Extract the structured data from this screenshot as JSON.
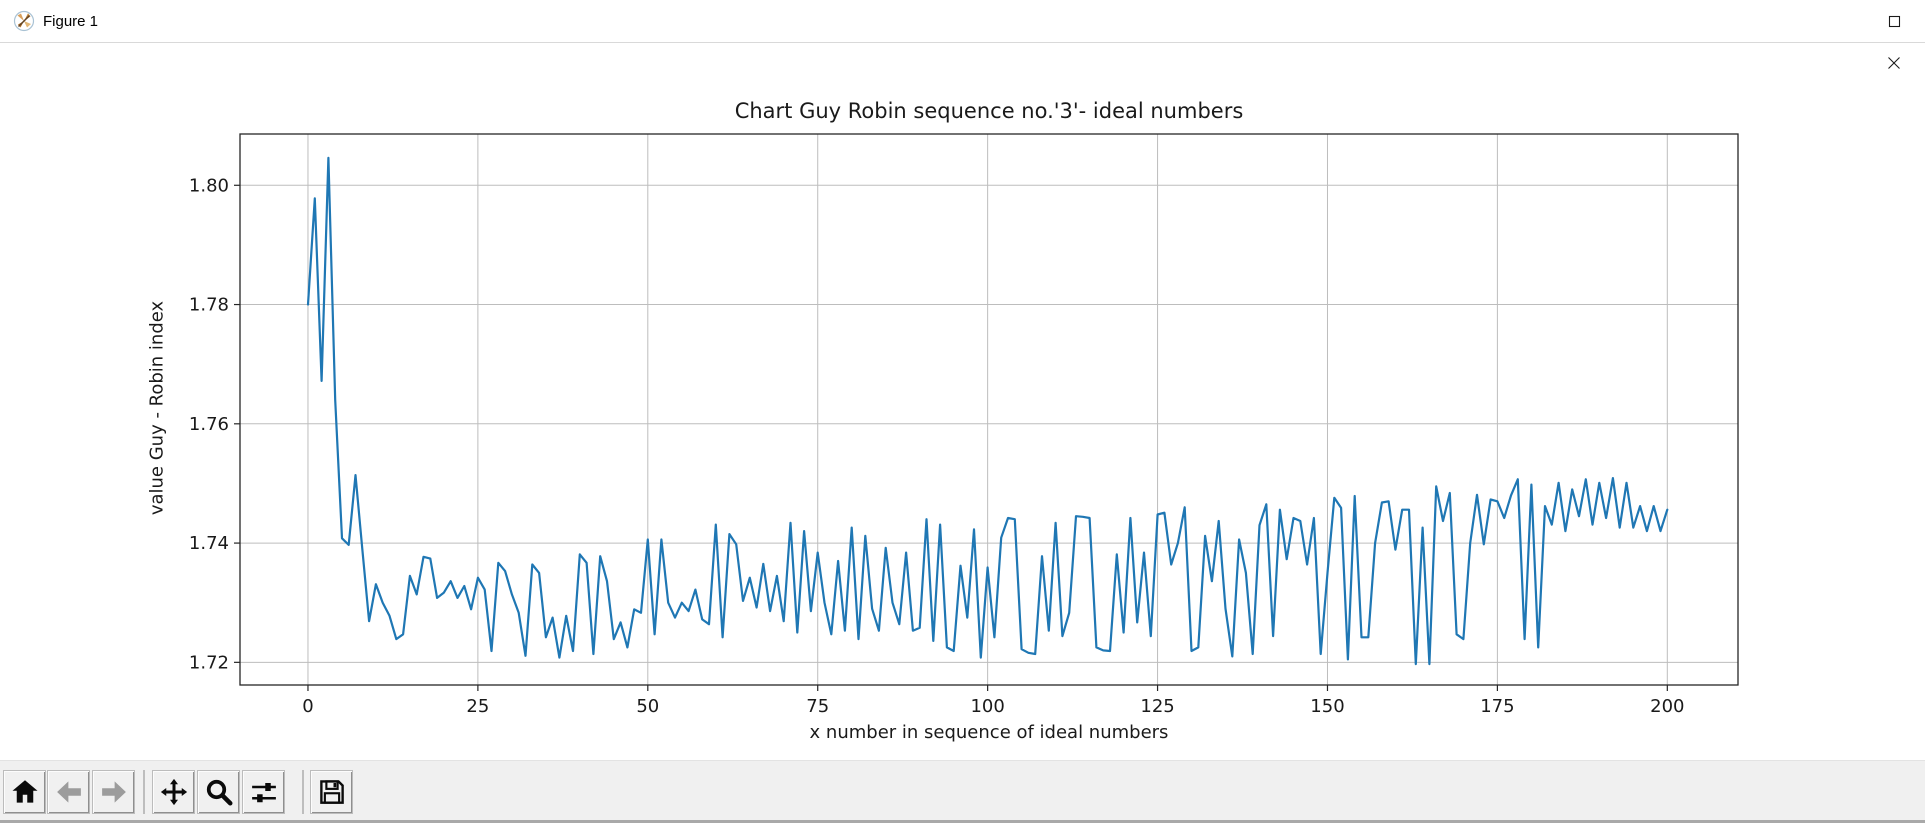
{
  "window": {
    "title": "Figure 1",
    "app_icon": "matplotlib-logo-icon",
    "controls": [
      {
        "name": "minimize-button",
        "icon": "minimize-icon"
      },
      {
        "name": "maximize-button",
        "icon": "maximize-icon"
      },
      {
        "name": "close-button",
        "icon": "close-icon"
      }
    ]
  },
  "toolbar": {
    "buttons": [
      {
        "name": "home-button",
        "icon": "home-icon",
        "enabled": true
      },
      {
        "name": "back-button",
        "icon": "back-arrow-icon",
        "enabled": false
      },
      {
        "name": "forward-button",
        "icon": "forward-arrow-icon",
        "enabled": false
      },
      {
        "name": "pan-button",
        "icon": "pan-arrows-icon",
        "enabled": true
      },
      {
        "name": "zoom-button",
        "icon": "zoom-magnifier-icon",
        "enabled": true
      },
      {
        "name": "subplots-button",
        "icon": "subplots-sliders-icon",
        "enabled": true
      },
      {
        "name": "save-button",
        "icon": "save-floppy-icon",
        "enabled": true
      }
    ]
  },
  "colors": {
    "line": "#1f77b4",
    "grid": "#bdbdbd",
    "spine": "#262626",
    "text": "#1a1a1a",
    "toolbar_bg": "#f0f0f0",
    "titlebar_bg": "#ffffff"
  },
  "chart_data": {
    "type": "line",
    "title": "Chart Guy Robin sequence no.'3'- ideal numbers",
    "xlabel": "x number in sequence of ideal numbers",
    "ylabel": "value Guy - Robin index",
    "x_range": [
      0,
      200
    ],
    "x_step": 1,
    "xlim": [
      -10,
      210.4
    ],
    "ylim": [
      1.7162,
      1.8086
    ],
    "xticks": [
      0,
      25,
      50,
      75,
      100,
      125,
      150,
      175,
      200
    ],
    "xtick_labels": [
      "0",
      "25",
      "50",
      "75",
      "100",
      "125",
      "150",
      "175",
      "200"
    ],
    "yticks": [
      1.72,
      1.74,
      1.76,
      1.78,
      1.8
    ],
    "ytick_labels": [
      "1.72",
      "1.74",
      "1.76",
      "1.78",
      "1.80"
    ],
    "grid": true,
    "legend": null,
    "line_color": "#1f77b4",
    "values": [
      1.78,
      1.7978,
      1.7672,
      1.8046,
      1.764,
      1.7408,
      1.7397,
      1.7514,
      1.739,
      1.7269,
      1.7331,
      1.73,
      1.7278,
      1.7239,
      1.7247,
      1.7345,
      1.7314,
      1.7377,
      1.7374,
      1.7308,
      1.7317,
      1.7336,
      1.7308,
      1.7328,
      1.7289,
      1.7342,
      1.7322,
      1.7219,
      1.7367,
      1.7353,
      1.7314,
      1.7283,
      1.7211,
      1.7364,
      1.735,
      1.7242,
      1.7275,
      1.7208,
      1.7278,
      1.7219,
      1.7381,
      1.7367,
      1.7214,
      1.7378,
      1.7336,
      1.7239,
      1.7267,
      1.7225,
      1.7289,
      1.7283,
      1.7406,
      1.7247,
      1.7406,
      1.73,
      1.7275,
      1.73,
      1.7286,
      1.7322,
      1.7272,
      1.7264,
      1.7431,
      1.7242,
      1.7415,
      1.7398,
      1.7303,
      1.7342,
      1.7292,
      1.7365,
      1.7286,
      1.7345,
      1.7269,
      1.7434,
      1.725,
      1.742,
      1.7286,
      1.7384,
      1.73,
      1.7247,
      1.737,
      1.7253,
      1.7426,
      1.7239,
      1.7412,
      1.729,
      1.7253,
      1.7392,
      1.73,
      1.7264,
      1.7384,
      1.7253,
      1.7258,
      1.744,
      1.7236,
      1.7431,
      1.7225,
      1.7219,
      1.7362,
      1.7275,
      1.7423,
      1.7208,
      1.7359,
      1.7242,
      1.7409,
      1.7442,
      1.744,
      1.7222,
      1.7216,
      1.7214,
      1.7378,
      1.7253,
      1.7434,
      1.7244,
      1.7283,
      1.7445,
      1.7444,
      1.7442,
      1.7225,
      1.722,
      1.7219,
      1.7381,
      1.725,
      1.7442,
      1.7267,
      1.7384,
      1.7244,
      1.7448,
      1.7451,
      1.7364,
      1.74,
      1.746,
      1.7219,
      1.7225,
      1.7412,
      1.7336,
      1.7437,
      1.729,
      1.721,
      1.7406,
      1.735,
      1.7214,
      1.743,
      1.7465,
      1.7244,
      1.7456,
      1.7373,
      1.7442,
      1.7437,
      1.7364,
      1.7442,
      1.7214,
      1.735,
      1.7476,
      1.7459,
      1.7205,
      1.7479,
      1.7242,
      1.7242,
      1.74,
      1.7468,
      1.747,
      1.7389,
      1.7456,
      1.7456,
      1.7197,
      1.7426,
      1.7197,
      1.7495,
      1.7437,
      1.7484,
      1.7247,
      1.7239,
      1.74,
      1.7481,
      1.7398,
      1.7473,
      1.747,
      1.7442,
      1.748,
      1.7507,
      1.7239,
      1.7498,
      1.7225,
      1.7462,
      1.7431,
      1.7501,
      1.742,
      1.749,
      1.7445,
      1.7507,
      1.7431,
      1.7501,
      1.7442,
      1.7509,
      1.7426,
      1.7501,
      1.7426,
      1.7462,
      1.742,
      1.7462,
      1.742,
      1.7456
    ]
  }
}
